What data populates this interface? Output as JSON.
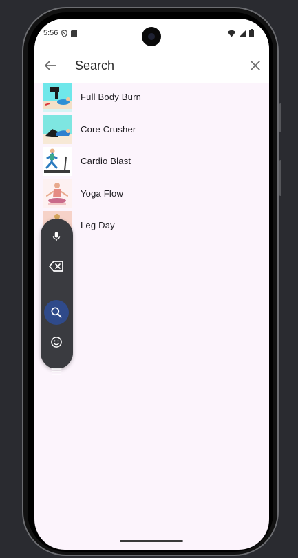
{
  "status_bar": {
    "time": "5:56"
  },
  "app_bar": {
    "search_placeholder": "Search"
  },
  "results": [
    {
      "label": "Full Body Burn"
    },
    {
      "label": "Core Crusher"
    },
    {
      "label": "Cardio Blast"
    },
    {
      "label": "Yoga Flow"
    },
    {
      "label": "Leg Day"
    }
  ],
  "toolbar": {
    "buttons": [
      "mic-icon",
      "backspace-icon",
      "search-icon",
      "emoji-icon",
      "menu-icon"
    ],
    "active": "search-icon",
    "active_color": "#2f4a8a"
  },
  "colors": {
    "screen_bg": "#fcf4fc",
    "toolbar_bg": "#3a3b40"
  }
}
